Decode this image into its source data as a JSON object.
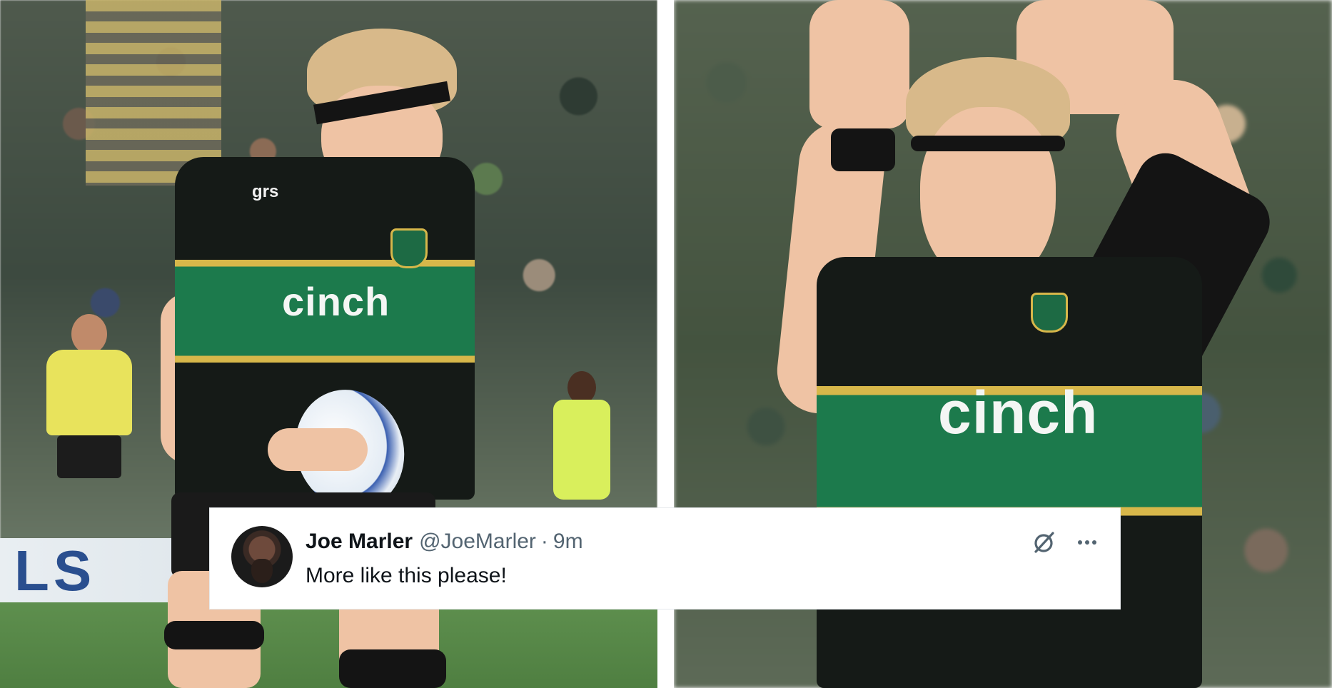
{
  "tweet": {
    "display_name": "Joe Marler",
    "handle": "@JoeMarler",
    "separator": "·",
    "timestamp": "9m",
    "text": "More like this please!"
  },
  "photos": {
    "left": {
      "shirt_sponsor": "cinch",
      "shoulder_sponsor": "grs",
      "hoarding_text": "LS"
    },
    "right": {
      "shirt_sponsor": "cinch"
    }
  },
  "colors": {
    "jersey_green": "#1c7a4c",
    "jersey_black": "#151a17",
    "jersey_gold": "#d7b74a",
    "name_text": "#0f1419",
    "secondary_text": "#536471"
  },
  "icons": {
    "grok": "grok-icon",
    "more": "more-icon"
  }
}
